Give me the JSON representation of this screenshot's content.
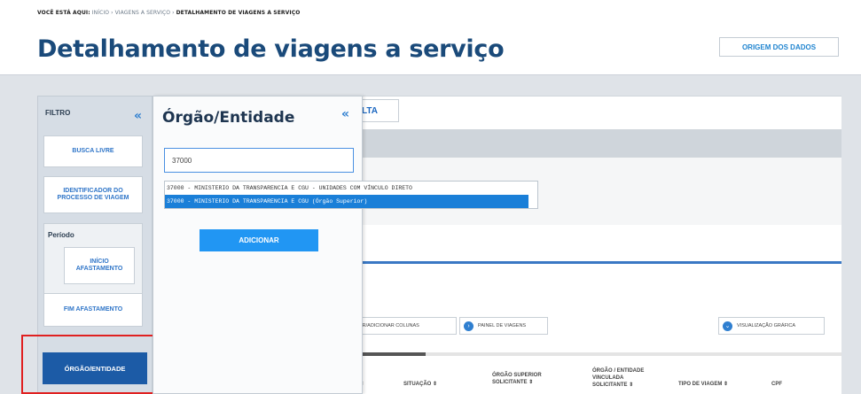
{
  "breadcrumb": {
    "prefix": "VOCÊ ESTÁ AQUI:",
    "path": "INÍCIO › VIAGENS A SERVIÇO ›",
    "current": "DETALHAMENTO DE VIAGENS A SERVIÇO"
  },
  "header": {
    "title": "Detalhamento de viagens a serviço",
    "origem_label": "ORIGEM DOS DADOS"
  },
  "sidebar": {
    "title": "FILTRO",
    "collapse_glyph": "«",
    "busca_livre": "BUSCA LIVRE",
    "identificador": "IDENTIFICADOR DO PROCESSO DE VIAGEM",
    "periodo_label": "Período",
    "inicio_afastamento": "INÍCIO AFASTAMENTO",
    "fim_afastamento": "FIM AFASTAMENTO",
    "orgao_entidade": "ÓRGÃO/ENTIDADE"
  },
  "panel": {
    "title": "Órgão/Entidade",
    "collapse_glyph": "«",
    "input_value": "37000",
    "options": [
      "37000 - MINISTERIO DA TRANSPARENCIA E CGU - UNIDADES COM VÍNCULO DIRETO",
      "37000 - MINISTERIO DA TRANSPARENCIA E CGU (Órgão Superior)"
    ],
    "selected_index": 1,
    "add_label": "ADICIONAR"
  },
  "consulta_tab": "LTA",
  "toolbar": {
    "colunas_label": "ER/ADICIONAR COLUNAS",
    "painel_label": "PAINEL DE VIAGENS",
    "grafica_label": "VISUALIZAÇÃO GRÁFICA"
  },
  "table": {
    "headers": [
      "S ⇕",
      "SITUAÇÃO ⇕",
      "ÓRGÃO SUPERIOR SOLICITANTE ⇕",
      "ÓRGÃO / ENTIDADE VINCULADA SOLICITANTE ⇕",
      "TIPO DE VIAGEM ⇕",
      "CPF"
    ]
  },
  "colors": {
    "title_blue": "#1a4a7a",
    "accent_blue": "#2196f3",
    "selected_blue": "#1a7fd8",
    "orgao_button": "#1c5ba6",
    "highlight_red": "#e02020"
  }
}
